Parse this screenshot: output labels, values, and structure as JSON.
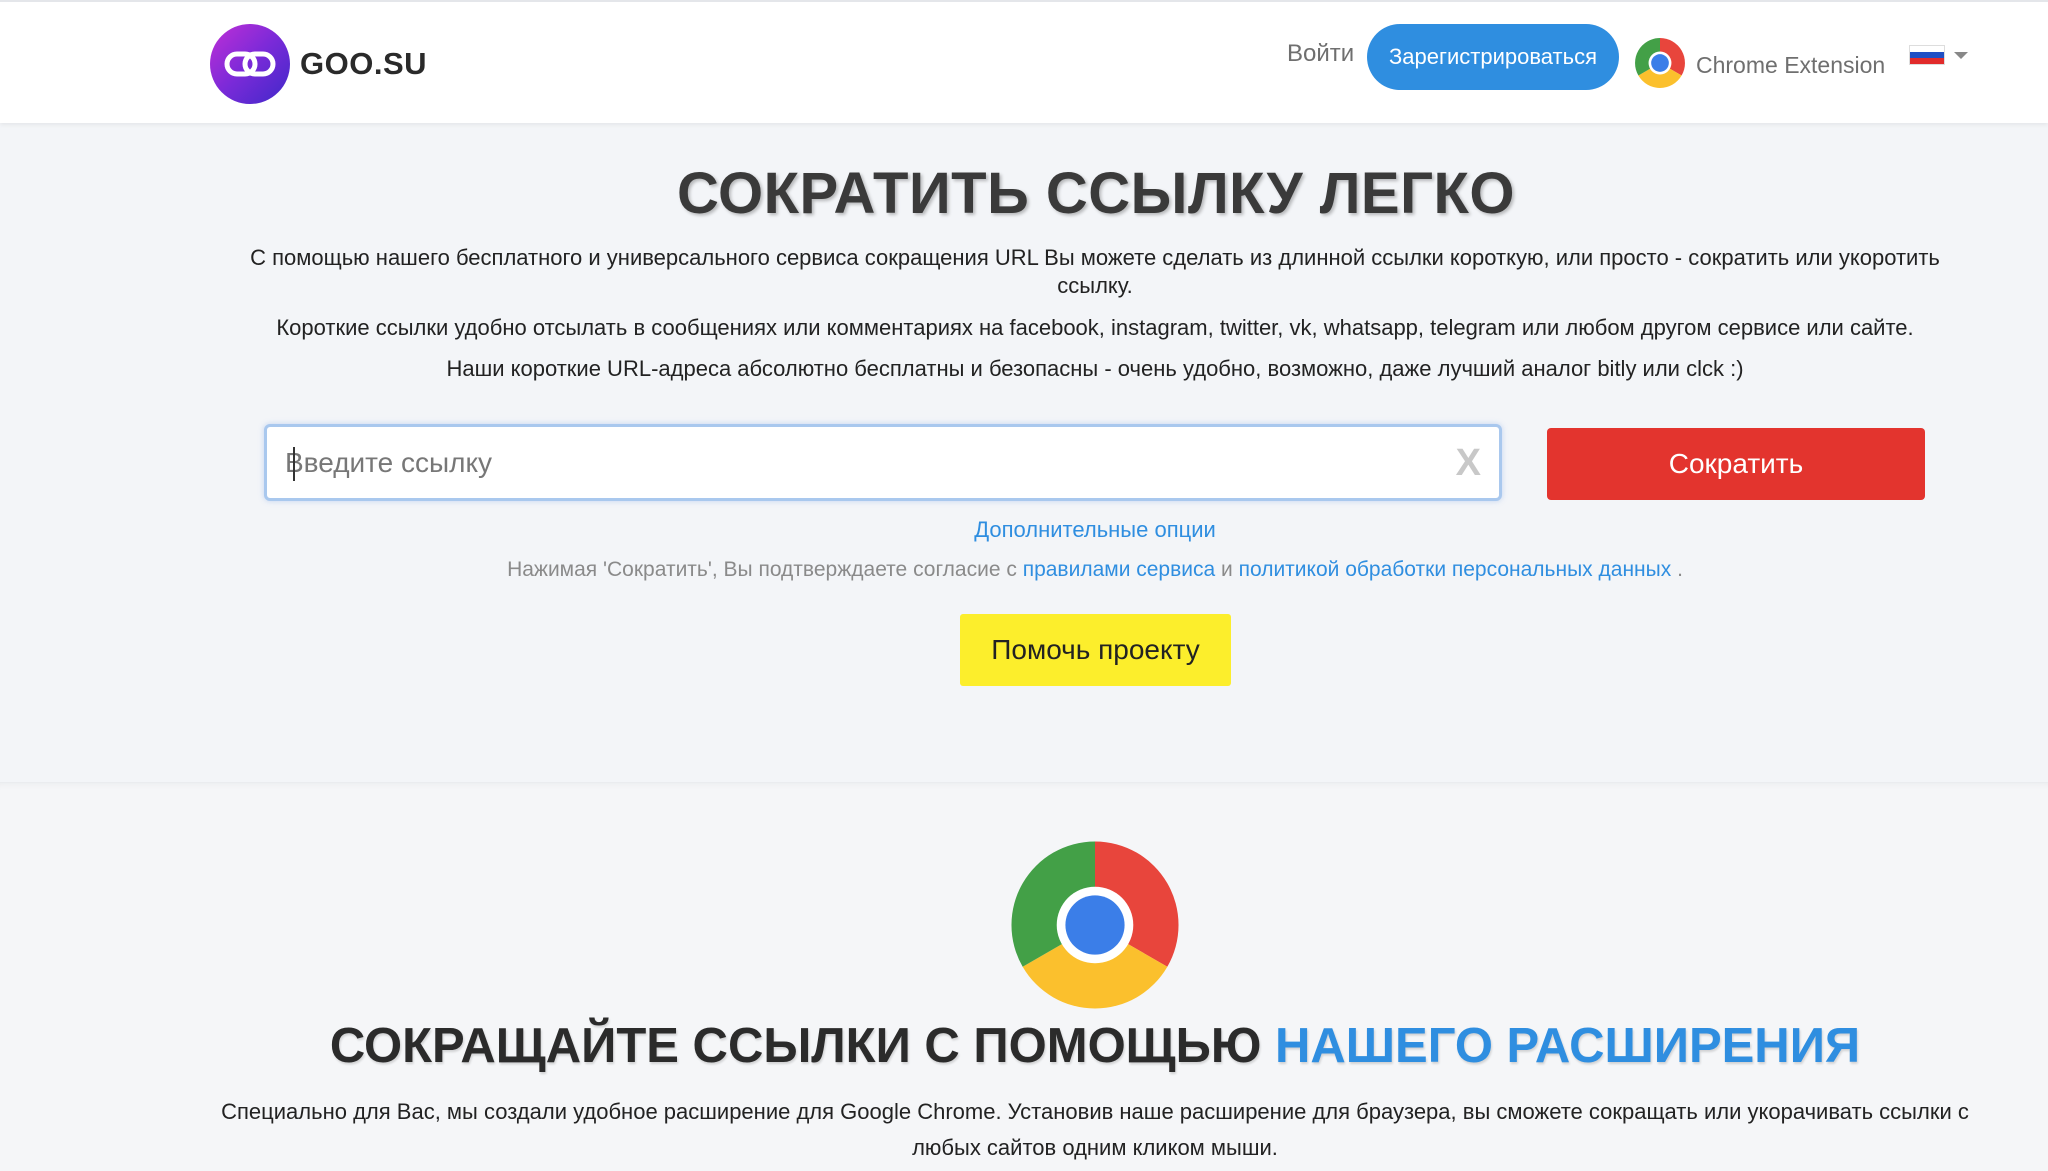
{
  "header": {
    "logo_text": "GOO.SU",
    "login_label": "Войти",
    "register_label": "Зарегистрироваться",
    "extension_label": "Chrome Extension",
    "language_flag_colors": [
      "#ffffff",
      "#1f4fc4",
      "#e12b2b"
    ]
  },
  "hero": {
    "title": "СОКРАТИТЬ ССЫЛКУ ЛЕГКО",
    "paragraph1": "С помощью нашего бесплатного и универсального сервиса сокращения URL Вы можете сделать из длинной ссылки короткую, или просто - сократить или укоротить ссылку.",
    "paragraph2": "Короткие ссылки удобно отсылать в сообщениях или комментариях на facebook, instagram, twitter, vk, whatsapp, telegram или любом другом сервисе или сайте.",
    "paragraph3": "Наши короткие URL-адреса абсолютно бесплатны и безопасны - очень удобно, возможно, даже лучший аналог bitly или clck :)"
  },
  "form": {
    "url_placeholder": "Введите ссылку",
    "url_value": "",
    "clear_label": "X",
    "shorten_label": "Сократить",
    "extra_options_label": "Дополнительные опции",
    "consent_prefix": "Нажимая 'Сократить', Вы подтверждаете согласие с",
    "consent_link1": "правилами сервиса",
    "consent_and": "и",
    "consent_link2": "политикой обработки персональных данных",
    "consent_suffix": ".",
    "help_label": "Помочь проекту"
  },
  "extension_section": {
    "title_part1": "СОКРАЩАЙТЕ ССЫЛКИ С ПОМОЩЬЮ",
    "title_part2": "НАШЕГО РАСШИРЕНИЯ",
    "description": "Специально для Вас, мы создали удобное расширение для Google Chrome. Установив наше расширение для браузера, вы сможете сокращать или укорачивать ссылки с любых сайтов одним кликом мыши."
  },
  "colors": {
    "accent_blue": "#2f8ee0",
    "shorten_red": "#e3342e",
    "help_yellow": "#fcee2c"
  }
}
